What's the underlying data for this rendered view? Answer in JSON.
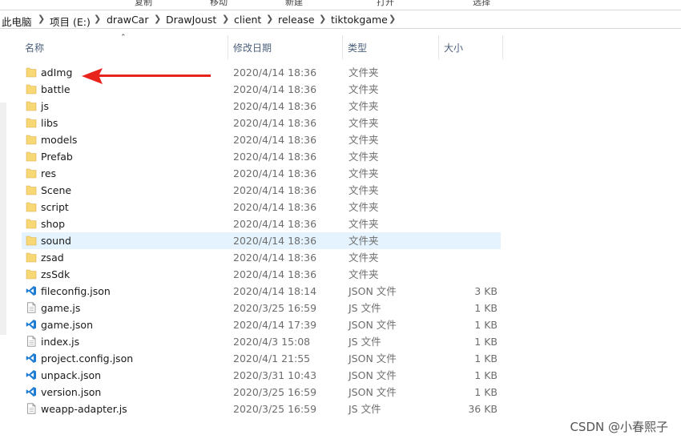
{
  "ribbon": {
    "fragments": [
      "复制",
      "移动",
      "新建",
      "打开",
      "选择"
    ]
  },
  "address": {
    "items": [
      "此电脑",
      "项目 (E:)",
      "drawCar",
      "DrawJoust",
      "client",
      "release",
      "tiktokgame"
    ]
  },
  "columns": {
    "name": "名称",
    "date": "修改日期",
    "type": "类型",
    "size": "大小"
  },
  "files": [
    {
      "name": "adImg",
      "date": "2020/4/14 18:36",
      "type": "文件夹",
      "size": "",
      "icon": "folder-icon"
    },
    {
      "name": "battle",
      "date": "2020/4/14 18:36",
      "type": "文件夹",
      "size": "",
      "icon": "folder-icon"
    },
    {
      "name": "js",
      "date": "2020/4/14 18:36",
      "type": "文件夹",
      "size": "",
      "icon": "folder-icon"
    },
    {
      "name": "libs",
      "date": "2020/4/14 18:36",
      "type": "文件夹",
      "size": "",
      "icon": "folder-icon"
    },
    {
      "name": "models",
      "date": "2020/4/14 18:36",
      "type": "文件夹",
      "size": "",
      "icon": "folder-icon"
    },
    {
      "name": "Prefab",
      "date": "2020/4/14 18:36",
      "type": "文件夹",
      "size": "",
      "icon": "folder-icon"
    },
    {
      "name": "res",
      "date": "2020/4/14 18:36",
      "type": "文件夹",
      "size": "",
      "icon": "folder-icon"
    },
    {
      "name": "Scene",
      "date": "2020/4/14 18:36",
      "type": "文件夹",
      "size": "",
      "icon": "folder-icon"
    },
    {
      "name": "script",
      "date": "2020/4/14 18:36",
      "type": "文件夹",
      "size": "",
      "icon": "folder-icon"
    },
    {
      "name": "shop",
      "date": "2020/4/14 18:36",
      "type": "文件夹",
      "size": "",
      "icon": "folder-icon"
    },
    {
      "name": "sound",
      "date": "2020/4/14 18:36",
      "type": "文件夹",
      "size": "",
      "icon": "folder-icon",
      "selected": true
    },
    {
      "name": "zsad",
      "date": "2020/4/14 18:36",
      "type": "文件夹",
      "size": "",
      "icon": "folder-icon"
    },
    {
      "name": "zsSdk",
      "date": "2020/4/14 18:36",
      "type": "文件夹",
      "size": "",
      "icon": "folder-icon"
    },
    {
      "name": "fileconfig.json",
      "date": "2020/4/14 18:14",
      "type": "JSON 文件",
      "size": "3 KB",
      "icon": "vscode-icon"
    },
    {
      "name": "game.js",
      "date": "2020/3/25 16:59",
      "type": "JS 文件",
      "size": "1 KB",
      "icon": "document-icon"
    },
    {
      "name": "game.json",
      "date": "2020/4/14 17:39",
      "type": "JSON 文件",
      "size": "1 KB",
      "icon": "vscode-icon"
    },
    {
      "name": "index.js",
      "date": "2020/4/3 15:08",
      "type": "JS 文件",
      "size": "1 KB",
      "icon": "document-icon"
    },
    {
      "name": "project.config.json",
      "date": "2020/4/1 21:55",
      "type": "JSON 文件",
      "size": "1 KB",
      "icon": "vscode-icon"
    },
    {
      "name": "unpack.json",
      "date": "2020/3/31 10:43",
      "type": "JSON 文件",
      "size": "1 KB",
      "icon": "vscode-icon"
    },
    {
      "name": "version.json",
      "date": "2020/3/25 16:59",
      "type": "JSON 文件",
      "size": "1 KB",
      "icon": "vscode-icon"
    },
    {
      "name": "weapp-adapter.js",
      "date": "2020/3/25 16:59",
      "type": "JS 文件",
      "size": "36 KB",
      "icon": "document-icon"
    }
  ],
  "watermark": "CSDN @小春熙子",
  "colors": {
    "selection": "#e5f3ff",
    "folder": "#f8d775",
    "vscode": "#1f7ed4",
    "arrow": "#e8231b"
  }
}
